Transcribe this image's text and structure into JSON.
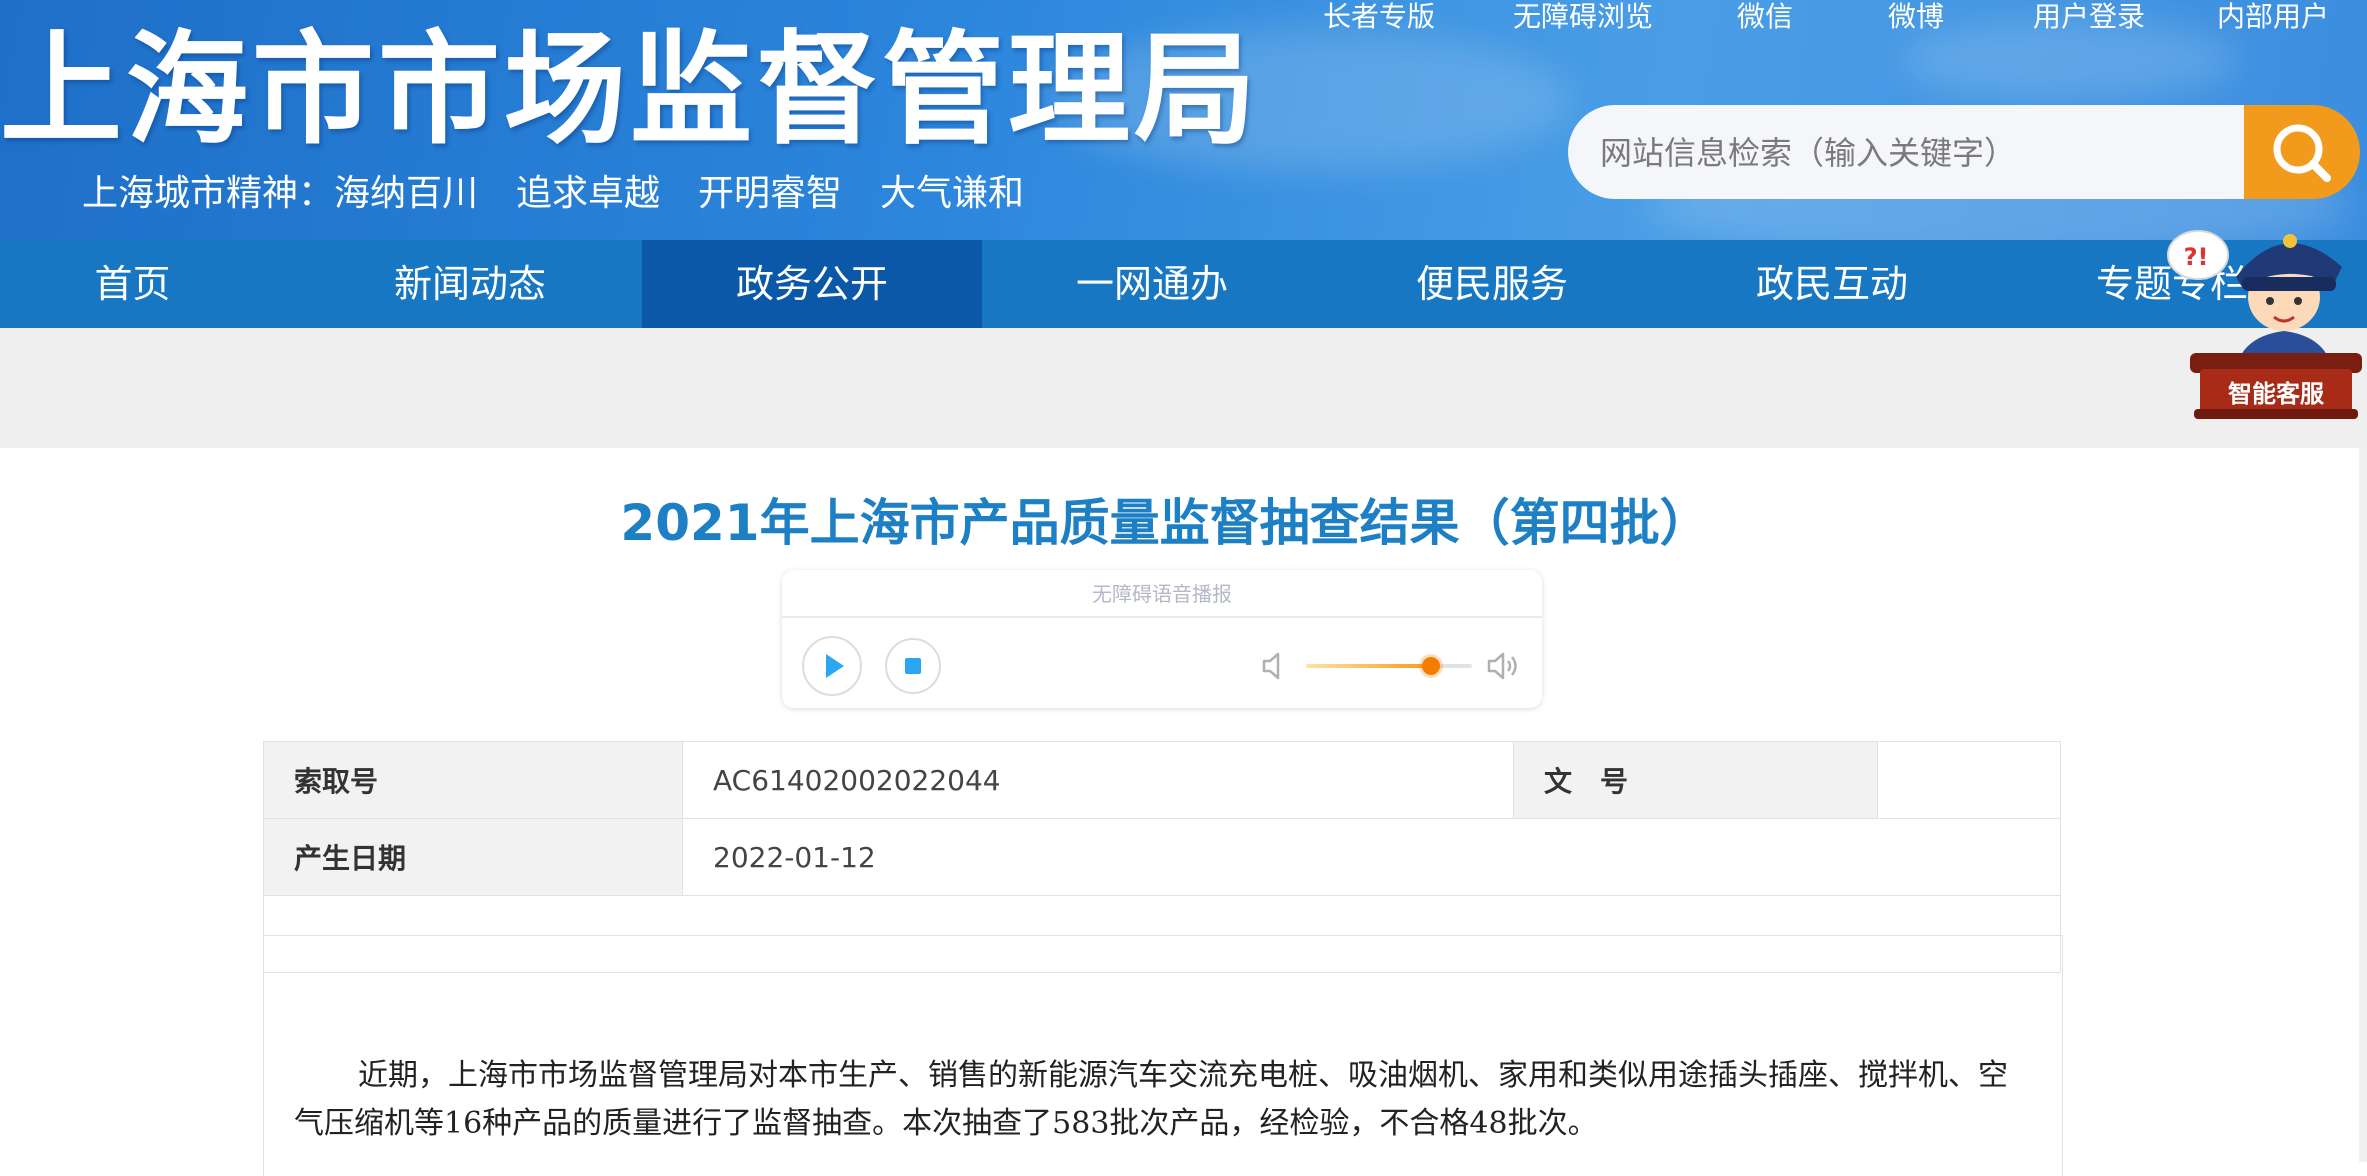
{
  "header": {
    "site_title": "上海市市场监督管理局",
    "motto": [
      "上海城市精神：海纳百川",
      "追求卓越",
      "开明睿智",
      "大气谦和"
    ],
    "top_links": [
      "长者专版",
      "无障碍浏览",
      "微信",
      "微博",
      "用户登录",
      "内部用户"
    ],
    "search": {
      "placeholder": "网站信息检索（输入关键字）",
      "icon": "search-icon"
    }
  },
  "nav": {
    "items": [
      "首页",
      "新闻动态",
      "政务公开",
      "一网通办",
      "便民服务",
      "政民互动",
      "专题专栏"
    ],
    "active": "政务公开"
  },
  "assistant": {
    "label": "智能客服",
    "bubble": "?!"
  },
  "article": {
    "title": "2021年上海市产品质量监督抽查结果（第四批）",
    "player": {
      "label": "无障碍语音播报",
      "play_icon": "play-icon",
      "stop_icon": "stop-icon",
      "volume_level": 0.75
    },
    "meta": {
      "index_label": "索取号",
      "index_value": "AC61402002022044",
      "doc_no_label": "文　号",
      "doc_no_value": "",
      "date_label": "产生日期",
      "date_value": "2022-01-12"
    },
    "body": "近期，上海市市场监督管理局对本市生产、销售的新能源汽车交流充电桩、吸油烟机、家用和类似用途插头插座、搅拌机、空气压缩机等16种产品的质量进行了监督抽查。本次抽查了583批次产品，经检验，不合格48批次。"
  },
  "colors": {
    "header_blue": "#2c86dc",
    "nav_blue": "#1877c2",
    "nav_active": "#0b58a8",
    "title_blue": "#1d7fc4",
    "search_orange": "#f29a1b"
  }
}
